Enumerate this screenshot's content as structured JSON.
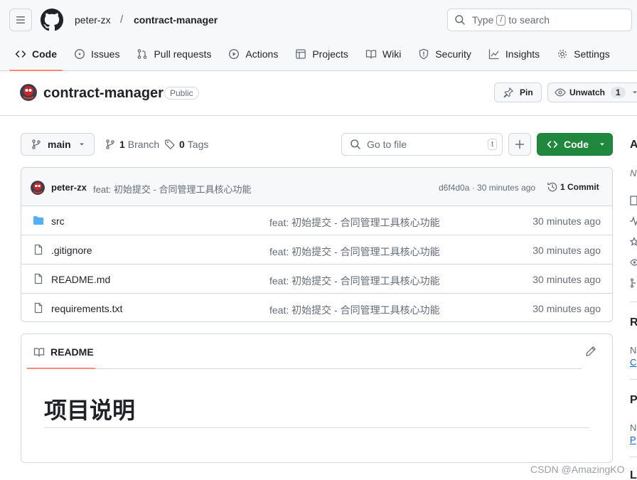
{
  "header": {
    "owner": "peter-zx",
    "separator": "/",
    "repo": "contract-manager",
    "search_prefix": "Type",
    "search_key": "/",
    "search_suffix": "to search"
  },
  "nav": [
    {
      "label": "Code",
      "icon": "code-icon",
      "selected": true
    },
    {
      "label": "Issues",
      "icon": "issue-icon"
    },
    {
      "label": "Pull requests",
      "icon": "pull-request-icon"
    },
    {
      "label": "Actions",
      "icon": "play-icon"
    },
    {
      "label": "Projects",
      "icon": "table-icon"
    },
    {
      "label": "Wiki",
      "icon": "book-icon"
    },
    {
      "label": "Security",
      "icon": "shield-icon"
    },
    {
      "label": "Insights",
      "icon": "graph-icon"
    },
    {
      "label": "Settings",
      "icon": "gear-icon"
    }
  ],
  "repo_header": {
    "title": "contract-manager",
    "visibility": "Public",
    "pin_label": "Pin",
    "unwatch_label": "Unwatch",
    "watch_count": "1"
  },
  "toolbar": {
    "branch": "main",
    "branch_count": "1",
    "branch_label": "Branch",
    "tag_count": "0",
    "tag_label": "Tags",
    "goto_placeholder": "Go to file",
    "goto_key": "t",
    "code_label": "Code"
  },
  "commit": {
    "author": "peter-zx",
    "message": "feat: 初始提交 - 合同管理工具核心功能",
    "meta": "d6f4d0a · 30 minutes ago",
    "count_label": "1 Commit"
  },
  "files": [
    {
      "name": "src",
      "type": "folder",
      "message": "feat: 初始提交 - 合同管理工具核心功能",
      "time": "30 minutes ago"
    },
    {
      "name": ".gitignore",
      "type": "file",
      "message": "feat: 初始提交 - 合同管理工具核心功能",
      "time": "30 minutes ago"
    },
    {
      "name": "README.md",
      "type": "file",
      "message": "feat: 初始提交 - 合同管理工具核心功能",
      "time": "30 minutes ago"
    },
    {
      "name": "requirements.txt",
      "type": "file",
      "message": "feat: 初始提交 - 合同管理工具核心功能",
      "time": "30 minutes ago"
    }
  ],
  "readme": {
    "tab_label": "README",
    "heading": "项目说明"
  },
  "sidebar": {
    "about_initial": "A",
    "about_sub": "N",
    "releases_initial": "R",
    "releases_sub": "N",
    "releases_link": "C",
    "packages_initial": "P",
    "packages_sub": "N",
    "packages_link": "P",
    "bottom_initial": "L"
  },
  "watermark": "CSDN @AmazingKO",
  "colors": {
    "accent_underline": "#fd8c73",
    "code_button": "#1f883d",
    "folder": "#54aeff",
    "link": "#0969da"
  }
}
